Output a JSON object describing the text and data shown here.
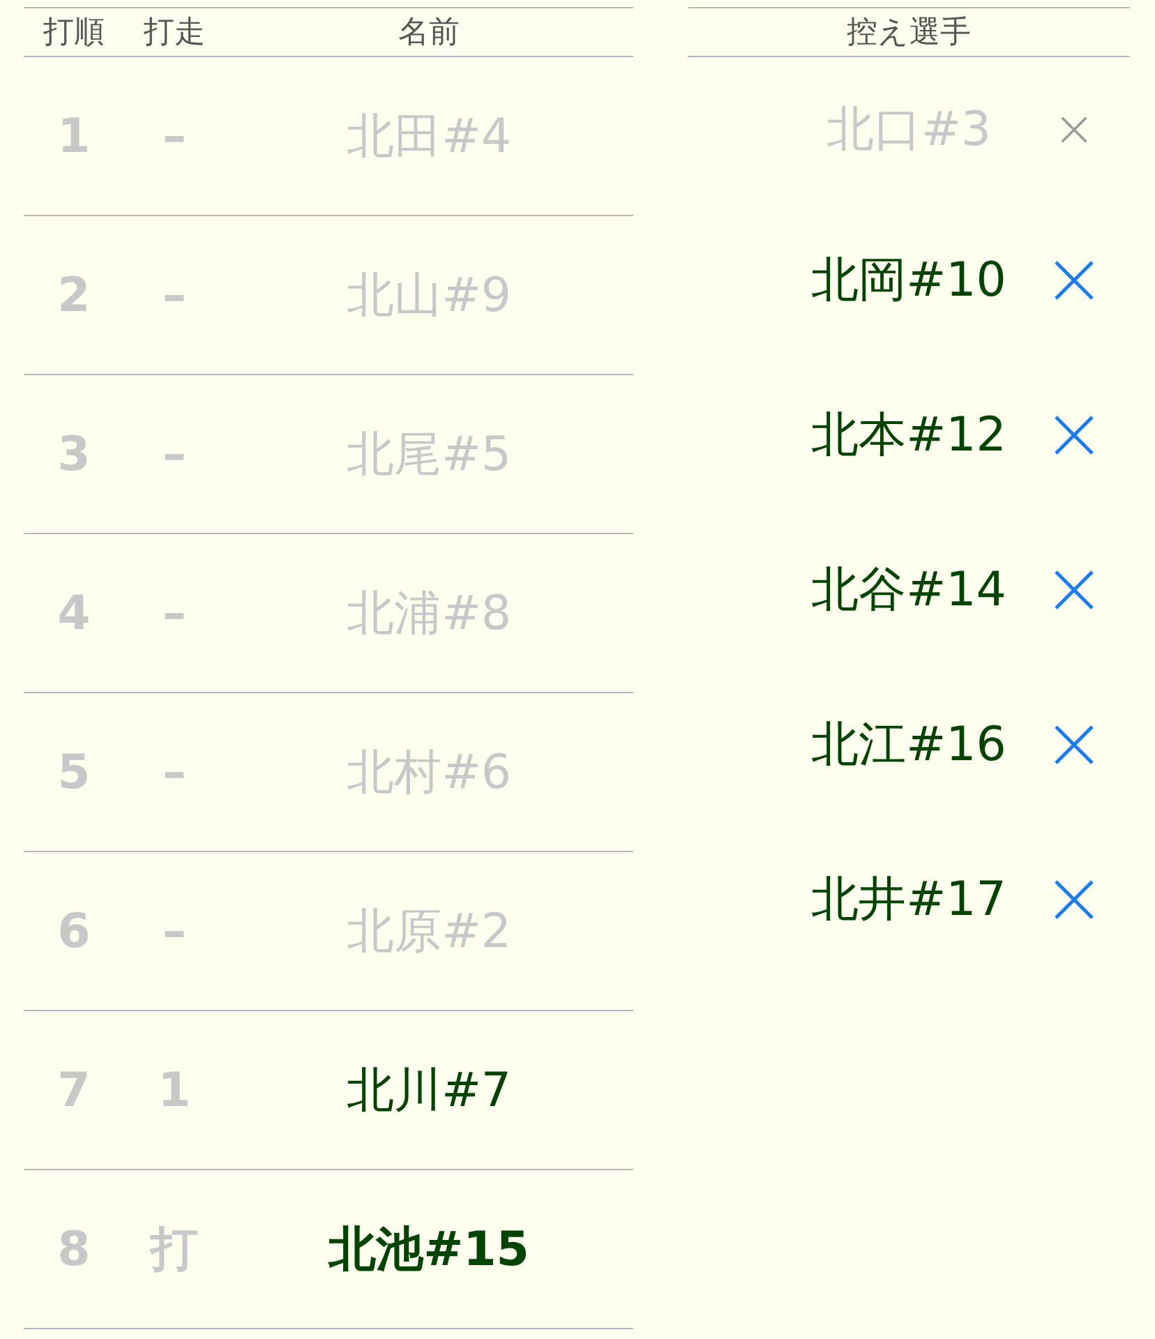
{
  "lineup": {
    "columns": [
      "打順",
      "打走",
      "名前"
    ],
    "rows": [
      {
        "order": "1",
        "runner": "–",
        "name": "北田#4",
        "disabled": true,
        "emphasized": false
      },
      {
        "order": "2",
        "runner": "–",
        "name": "北山#9",
        "disabled": true,
        "emphasized": false
      },
      {
        "order": "3",
        "runner": "–",
        "name": "北尾#5",
        "disabled": true,
        "emphasized": false
      },
      {
        "order": "4",
        "runner": "–",
        "name": "北浦#8",
        "disabled": true,
        "emphasized": false
      },
      {
        "order": "5",
        "runner": "–",
        "name": "北村#6",
        "disabled": true,
        "emphasized": false
      },
      {
        "order": "6",
        "runner": "–",
        "name": "北原#2",
        "disabled": true,
        "emphasized": false
      },
      {
        "order": "7",
        "runner": "1",
        "name": "北川#7",
        "disabled": false,
        "emphasized": false
      },
      {
        "order": "8",
        "runner": "打",
        "name": "北池#15",
        "disabled": false,
        "emphasized": true
      }
    ]
  },
  "bench": {
    "title": "控え選手",
    "players": [
      {
        "name": "北口#3",
        "disabled": true
      },
      {
        "name": "北岡#10",
        "disabled": false
      },
      {
        "name": "北本#12",
        "disabled": false
      },
      {
        "name": "北谷#14",
        "disabled": false
      },
      {
        "name": "北江#16",
        "disabled": false
      },
      {
        "name": "北井#17",
        "disabled": false
      }
    ]
  }
}
